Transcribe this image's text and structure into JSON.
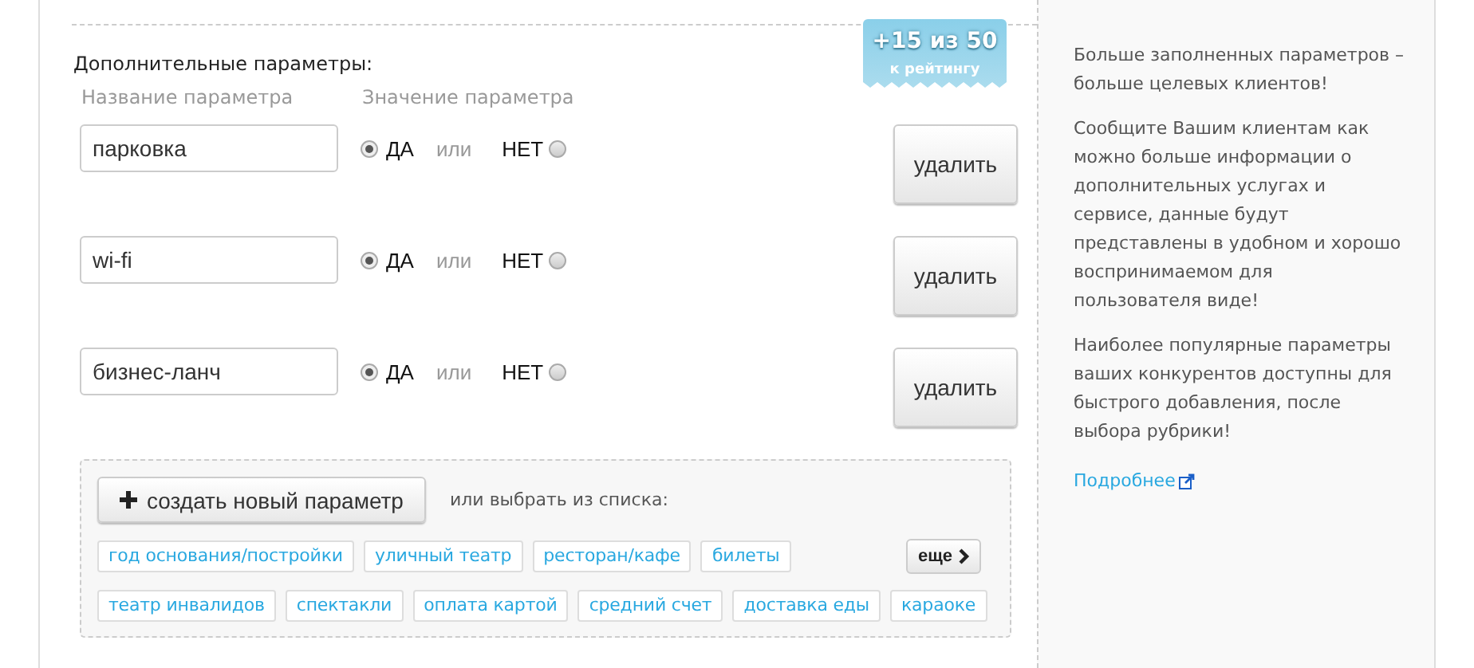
{
  "badge": {
    "score": "+15 из 50",
    "caption": "к рейтингу"
  },
  "section_title": "Дополнительные параметры:",
  "columns": [
    "Название параметра",
    "Значение параметра"
  ],
  "rows": [
    {
      "name": "парковка",
      "options": [
        {
          "label": "ДА",
          "selected": true
        },
        {
          "label": "НЕТ",
          "selected": false
        }
      ],
      "separator": "или",
      "button": "удалить"
    },
    {
      "name": "wi-fi",
      "options": [
        {
          "label": "ДА",
          "selected": true
        },
        {
          "label": "НЕТ",
          "selected": false
        }
      ],
      "separator": "или",
      "button": "удалить"
    },
    {
      "name": "бизнес-ланч",
      "options": [
        {
          "label": "ДА",
          "selected": true
        },
        {
          "label": "НЕТ",
          "selected": false
        }
      ],
      "separator": "или",
      "button": "удалить"
    }
  ],
  "add_box": {
    "create_button": "создать новый параметр",
    "or_text": "или выбрать из списка:",
    "more_button": "еще",
    "tag_rows": [
      {
        "tags": [
          "год основания/постройки",
          "уличный театр",
          "ресторан/кафе",
          "билеты"
        ]
      },
      {
        "tags": [
          "театр инвалидов",
          "спектакли",
          "оплата картой",
          "средний счет",
          "доставка еды",
          "караоке"
        ]
      }
    ]
  },
  "sidebar": {
    "paragraphs": [
      "Больше заполненных параметров – больше целевых клиентов!",
      "Сообщите Вашим клиентам как можно больше информации о дополнительных услугах и сервисе, данные будут представлены в удобном и хорошо воспринимаемом для пользователя виде!",
      "Наиболее популярные параметры ваших конкурентов доступны для быстрого добавления, после выбора рубрики!"
    ],
    "link": "Подробнее"
  }
}
